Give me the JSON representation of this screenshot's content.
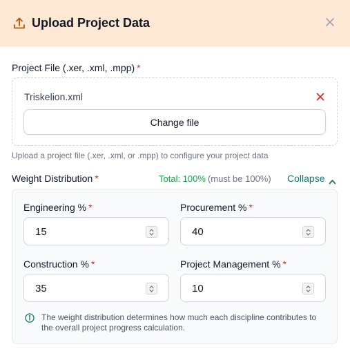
{
  "dialog": {
    "title": "Upload Project Data",
    "title_icon": "upload-icon",
    "close_icon": "close-icon"
  },
  "project_file": {
    "label": "Project File (.xer, .xml, .mpp)",
    "required_mark": "*",
    "file_name": "Triskelion.xml",
    "remove_icon": "remove-file-icon",
    "change_button_label": "Change file",
    "helper_text": "Upload a project file (.xer, .xml, or .mpp) to configure your project data"
  },
  "weights": {
    "label": "Weight Distribution",
    "required_mark": "*",
    "total_text": "Total: 100%",
    "total_note": "(must be 100%)",
    "collapse_label": "Collapse",
    "fields": [
      {
        "label": "Engineering %",
        "value": "15"
      },
      {
        "label": "Procurement %",
        "value": "40"
      },
      {
        "label": "Construction %",
        "value": "35"
      },
      {
        "label": "Project Management %",
        "value": "10"
      }
    ],
    "info_text": "The weight distribution determines how much each discipline contributes to the overall project progress calculation."
  },
  "colors": {
    "header_bg": "#fde8d4",
    "required": "#dc2626",
    "success": "#16a34a",
    "accent": "#0f766e"
  }
}
